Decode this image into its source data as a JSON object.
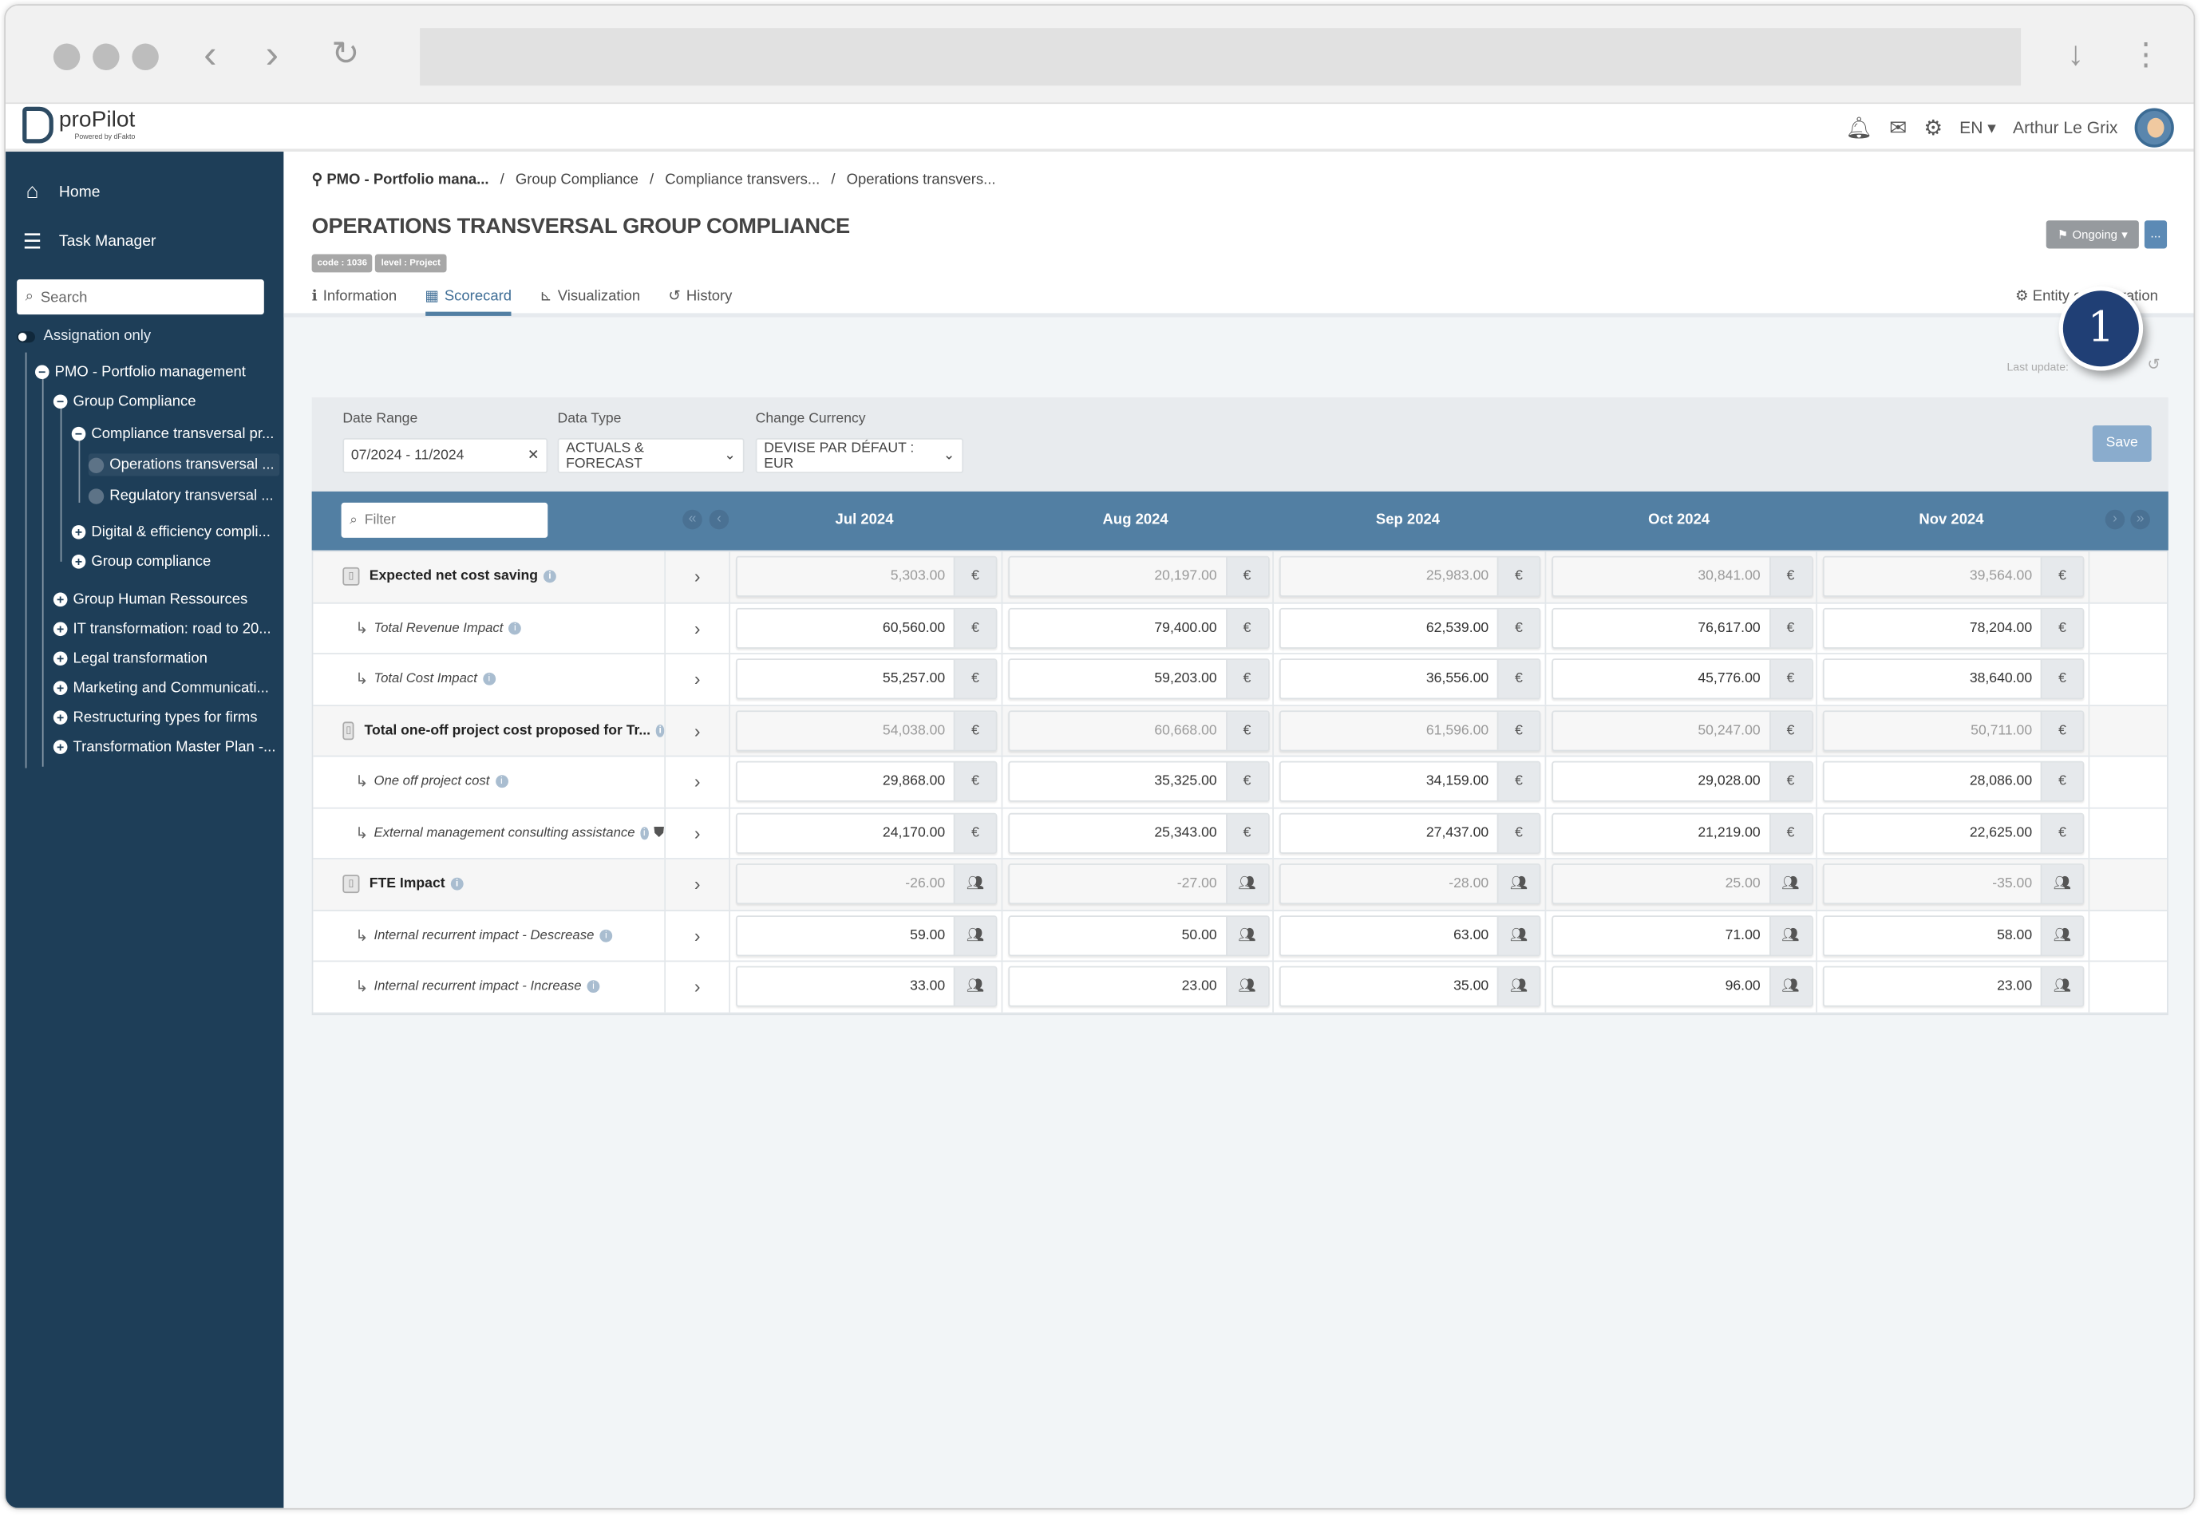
{
  "browser": {
    "address": ""
  },
  "app": {
    "logo": "proPilot",
    "logo_sub": "Powered by dFakto",
    "lang": "EN",
    "user": "Arthur Le Grix"
  },
  "sidebar": {
    "home": "Home",
    "task_manager": "Task Manager",
    "search_placeholder": "Search",
    "assignation": "Assignation only",
    "tree": [
      "PMO - Portfolio management",
      "Group Compliance",
      "Compliance transversal pr...",
      "Operations transversal ...",
      "Regulatory transversal ...",
      "Digital & efficiency compli...",
      "Group compliance",
      "Group Human Ressources",
      "IT transformation: road to 20...",
      "Legal transformation",
      "Marketing and Communicati...",
      "Restructuring types for firms",
      "Transformation Master Plan -..."
    ]
  },
  "breadcrumb": [
    "PMO - Portfolio mana...",
    "Group Compliance",
    "Compliance transvers...",
    "Operations transvers..."
  ],
  "page": {
    "title": "OPERATIONS TRANSVERSAL GROUP COMPLIANCE",
    "code": "code : 1036",
    "level": "level : Project",
    "status": "Ongoing",
    "more": "...",
    "entity_config": "Entity configuration",
    "last_update": "Last update:",
    "callout": "1"
  },
  "tabs": [
    "Information",
    "Scorecard",
    "Visualization",
    "History"
  ],
  "filters": {
    "date_range_label": "Date Range",
    "date_range": "07/2024 - 11/2024",
    "data_type_label": "Data Type",
    "data_type": "ACTUALS & FORECAST",
    "currency_label": "Change Currency",
    "currency": "DEVISE PAR DÉFAUT : EUR",
    "save": "Save"
  },
  "table": {
    "filter_placeholder": "Filter",
    "months": [
      "Jul 2024",
      "Aug 2024",
      "Sep 2024",
      "Oct 2024",
      "Nov 2024"
    ],
    "rows": [
      {
        "label": "Expected net cost saving",
        "type": "parent",
        "unit": "€",
        "values": [
          "5,303.00",
          "20,197.00",
          "25,983.00",
          "30,841.00",
          "39,564.00"
        ]
      },
      {
        "label": "Total Revenue Impact",
        "type": "child",
        "unit": "€",
        "values": [
          "60,560.00",
          "79,400.00",
          "62,539.00",
          "76,617.00",
          "78,204.00"
        ]
      },
      {
        "label": "Total Cost Impact",
        "type": "child",
        "unit": "€",
        "values": [
          "55,257.00",
          "59,203.00",
          "36,556.00",
          "45,776.00",
          "38,640.00"
        ]
      },
      {
        "label": "Total one-off project cost proposed for Tr...",
        "type": "parent",
        "unit": "€",
        "values": [
          "54,038.00",
          "60,668.00",
          "61,596.00",
          "50,247.00",
          "50,711.00"
        ]
      },
      {
        "label": "One off project cost",
        "type": "child",
        "unit": "€",
        "values": [
          "29,868.00",
          "35,325.00",
          "34,159.00",
          "29,028.00",
          "28,086.00"
        ]
      },
      {
        "label": "External management consulting assistance",
        "type": "child",
        "unit": "€",
        "shield": true,
        "values": [
          "24,170.00",
          "25,343.00",
          "27,437.00",
          "21,219.00",
          "22,625.00"
        ]
      },
      {
        "label": "FTE Impact",
        "type": "parent",
        "unit": "people-icon",
        "values": [
          "-26.00",
          "-27.00",
          "-28.00",
          "25.00",
          "-35.00"
        ]
      },
      {
        "label": "Internal recurrent impact - Descrease",
        "type": "child",
        "unit": "people-icon",
        "values": [
          "59.00",
          "50.00",
          "63.00",
          "71.00",
          "58.00"
        ]
      },
      {
        "label": "Internal recurrent impact - Increase",
        "type": "child",
        "unit": "people-icon",
        "values": [
          "33.00",
          "23.00",
          "35.00",
          "96.00",
          "23.00"
        ]
      }
    ]
  },
  "colors": {
    "sidebar": "#1e3e58",
    "header": "#527fa3",
    "callout": "#203f75",
    "save": "#8aaccd"
  }
}
